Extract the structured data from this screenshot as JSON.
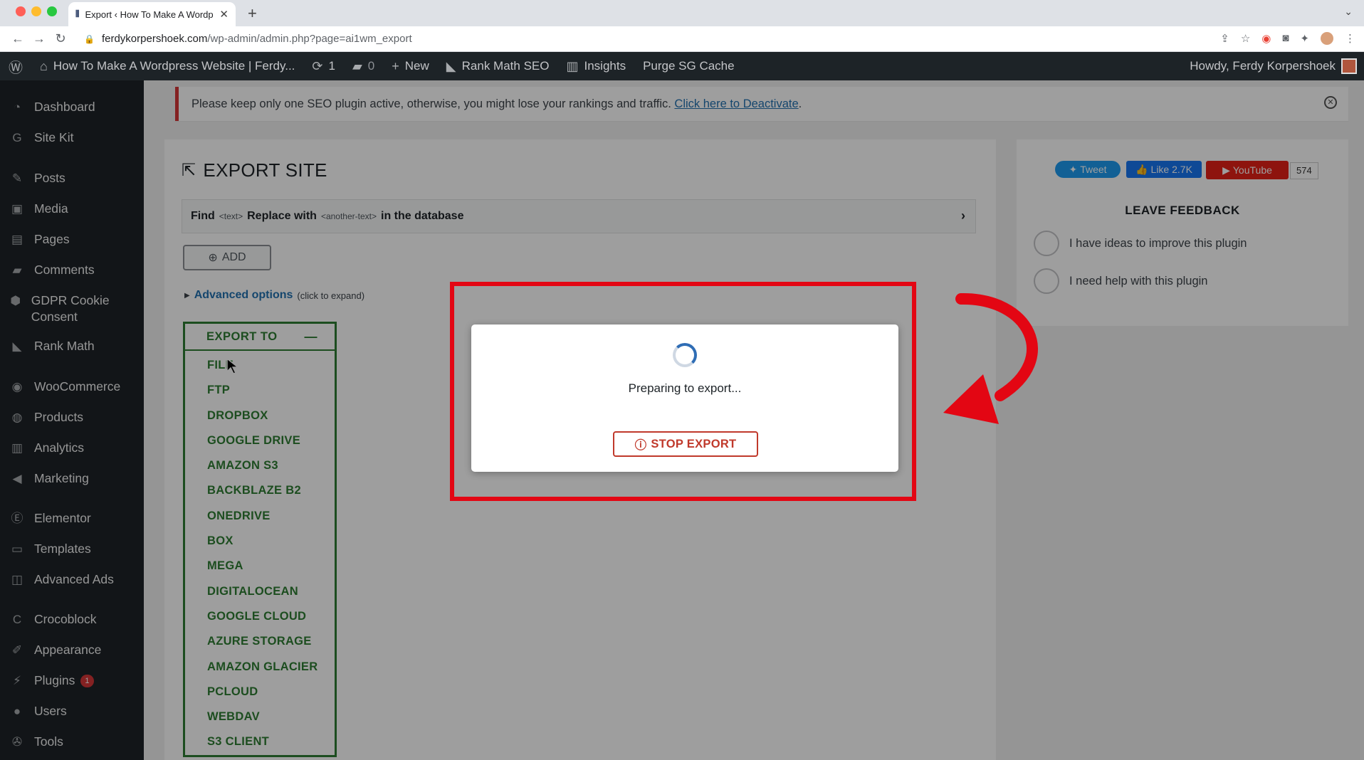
{
  "browser": {
    "tab_title": "Export ‹ How To Make A Wordp",
    "url_domain": "ferdykorpershoek.com",
    "url_path": "/wp-admin/admin.php?page=ai1wm_export"
  },
  "adminbar": {
    "site_name": "How To Make A Wordpress Website | Ferdy...",
    "updates_count": "1",
    "comments_count": "0",
    "new_label": "New",
    "rank_math": "Rank Math SEO",
    "insights": "Insights",
    "purge": "Purge SG Cache",
    "howdy": "Howdy, Ferdy Korpershoek"
  },
  "sidebar": {
    "items": [
      {
        "label": "Dashboard",
        "icon": "dashboard-icon"
      },
      {
        "label": "Site Kit",
        "icon": "sitekit-icon"
      },
      {
        "label": "Posts",
        "icon": "pin-icon"
      },
      {
        "label": "Media",
        "icon": "media-icon"
      },
      {
        "label": "Pages",
        "icon": "pages-icon"
      },
      {
        "label": "Comments",
        "icon": "comments-icon"
      },
      {
        "label": "GDPR Cookie Consent",
        "icon": "lock-icon"
      },
      {
        "label": "Rank Math",
        "icon": "rankmath-icon"
      },
      {
        "label": "WooCommerce",
        "icon": "woo-icon"
      },
      {
        "label": "Products",
        "icon": "products-icon"
      },
      {
        "label": "Analytics",
        "icon": "analytics-icon"
      },
      {
        "label": "Marketing",
        "icon": "megaphone-icon"
      },
      {
        "label": "Elementor",
        "icon": "elementor-icon"
      },
      {
        "label": "Templates",
        "icon": "folder-icon"
      },
      {
        "label": "Advanced Ads",
        "icon": "ads-icon"
      },
      {
        "label": "Crocoblock",
        "icon": "crocoblock-icon"
      },
      {
        "label": "Appearance",
        "icon": "brush-icon"
      },
      {
        "label": "Plugins",
        "icon": "plugin-icon",
        "badge": "1"
      },
      {
        "label": "Users",
        "icon": "users-icon"
      },
      {
        "label": "Tools",
        "icon": "wrench-icon"
      }
    ]
  },
  "notice": {
    "text": "Please keep only one SEO plugin active, otherwise, you might lose your rankings and traffic. ",
    "link": "Click here to Deactivate",
    "suffix": "."
  },
  "export": {
    "title": "EXPORT SITE",
    "find_label": "Find",
    "find_placeholder": "<text>",
    "replace_label": "Replace with",
    "replace_placeholder": "<another-text>",
    "db_label": "in the database",
    "add_label": "ADD",
    "advanced_label": "Advanced options",
    "advanced_hint": "(click to expand)",
    "export_to_label": "EXPORT TO",
    "options": [
      "FILE",
      "FTP",
      "DROPBOX",
      "GOOGLE DRIVE",
      "AMAZON S3",
      "BACKBLAZE B2",
      "ONEDRIVE",
      "BOX",
      "MEGA",
      "DIGITALOCEAN",
      "GOOGLE CLOUD",
      "AZURE STORAGE",
      "AMAZON GLACIER",
      "PCLOUD",
      "WEBDAV",
      "S3 CLIENT"
    ]
  },
  "feedback": {
    "tweet": "Tweet",
    "like": "Like 2.7K",
    "youtube": "YouTube",
    "youtube_count": "574",
    "title": "LEAVE FEEDBACK",
    "opt1": "I have ideas to improve this plugin",
    "opt2": "I need help with this plugin"
  },
  "modal": {
    "message": "Preparing to export...",
    "stop_label": "STOP EXPORT"
  },
  "colors": {
    "accent_green": "#2e7d32",
    "highlight_red": "#e30613",
    "wp_dark": "#1d2327"
  }
}
